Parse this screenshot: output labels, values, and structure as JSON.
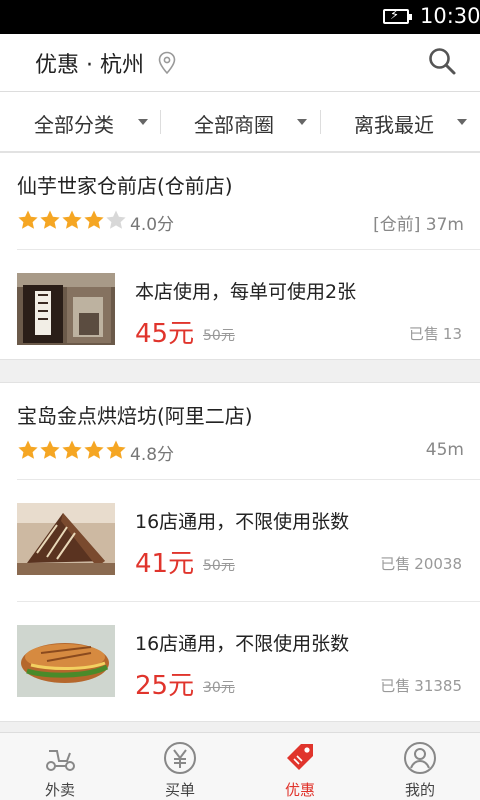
{
  "status_bar": {
    "time": "10:30"
  },
  "header": {
    "title": "优惠 · 杭州"
  },
  "filters": [
    {
      "label": "全部分类"
    },
    {
      "label": "全部商圈"
    },
    {
      "label": "离我最近"
    }
  ],
  "shops": [
    {
      "name": "仙芋世家仓前店(仓前店)",
      "rating": 4.0,
      "score_text": "4.0分",
      "distance": "[仓前] 37m",
      "deals": [
        {
          "title": "本店使用，每单可使用2张",
          "price": "45元",
          "original_price": "50元",
          "sold_label": "已售",
          "sold_count": "13"
        }
      ]
    },
    {
      "name": "宝岛金点烘焙坊(阿里二店)",
      "rating": 4.8,
      "score_text": "4.8分",
      "distance": "45m",
      "deals": [
        {
          "title": "16店通用，不限使用张数",
          "price": "41元",
          "original_price": "50元",
          "sold_label": "已售",
          "sold_count": "20038"
        },
        {
          "title": "16店通用，不限使用张数",
          "price": "25元",
          "original_price": "30元",
          "sold_label": "已售",
          "sold_count": "31385"
        }
      ]
    }
  ],
  "tabs": [
    {
      "label": "外卖",
      "icon": "scooter-icon",
      "active": false
    },
    {
      "label": "买单",
      "icon": "yuan-icon",
      "active": false
    },
    {
      "label": "优惠",
      "icon": "tag-icon",
      "active": true
    },
    {
      "label": "我的",
      "icon": "profile-icon",
      "active": false
    }
  ],
  "colors": {
    "accent": "#e0342c",
    "star": "#f5a623",
    "star_empty": "#d8d8d8"
  }
}
